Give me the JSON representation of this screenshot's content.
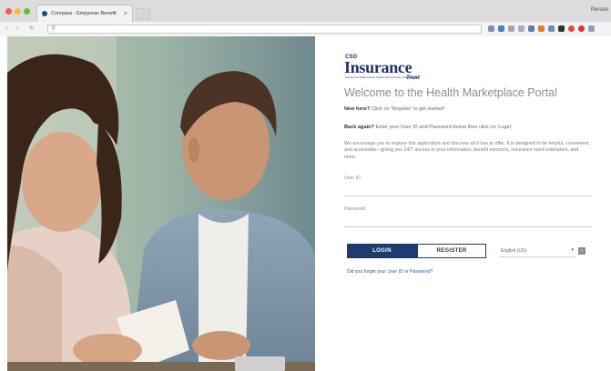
{
  "browser": {
    "tab_title": "Compass - Empyrean Benefit",
    "tab_close": "×",
    "profile": "Person"
  },
  "logo": {
    "prefix": "CSD",
    "main": "Insurance",
    "suffix": "Trust",
    "tagline": "Serving K-12 Public Schools, Charter and Community College Districts"
  },
  "page": {
    "welcome": "Welcome to the Health Marketplace Portal",
    "new_here_label": "New here?",
    "new_here_text": " Click on 'Register' to get started!",
    "back_again_label": "Back again?",
    "back_again_text": " Enter your User ID and Password below then click on 'Login'",
    "intro_paragraph": "We encourage you to explore this application and discover all it has to offer. It is designed to be helpful, convenient, and accessible—giving you 24/7 access to your information, benefit elections, insurance need estimators, and more."
  },
  "form": {
    "user_id_label": "User ID",
    "password_label": "Password",
    "login_label": "LOGIN",
    "register_label": "REGISTER",
    "language_value": "English (US)",
    "language_caret": "▾",
    "forgot_prefix": "Did you forget your ",
    "forgot_user_id": "User ID",
    "forgot_or": " or ",
    "forgot_password": "Password",
    "forgot_suffix": "?"
  },
  "colors": {
    "accent_navy": "#1f3c6e",
    "logo_navy": "#1f2f6b",
    "link_blue": "#2a5ca8",
    "heading_gray": "#8a8f96"
  }
}
